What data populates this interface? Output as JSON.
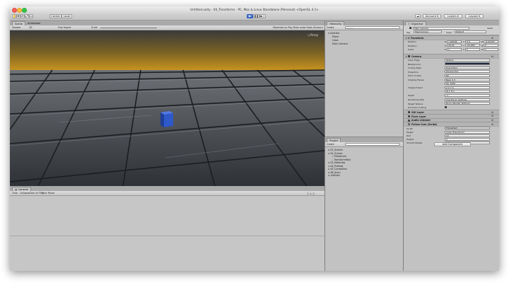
{
  "titlebar": {
    "title": "Untitled.unity - 04_Transforms - PC, Mac & Linux Standalone (Personal) <OpenGL 4.1>"
  },
  "toolbar": {
    "center_label": "Center",
    "local_label": "Local",
    "play_icon": "play-icon",
    "pause_icon": "pause-icon",
    "step_icon": "step-icon",
    "account_label": "Account",
    "layers_label": "Layers",
    "layout_label": "Layout"
  },
  "scene": {
    "tabs": [
      "Scene",
      "Animation"
    ],
    "shading_mode": "Shaded",
    "dimension_mode": "2D",
    "right_labels": "Gizmos ▾ (Q*All)",
    "game_subbar": [
      "Free Aspect",
      "Scale",
      "1x"
    ],
    "game_right": "Maximize on Play   Mute audio   Stats   Gizmos ▾"
  },
  "hierarchy": {
    "tab": "Hierarchy",
    "create_label": "Create",
    "search_placeholder": "Q*All",
    "scene_name": "Untitled",
    "items": [
      "Plane",
      "Cube",
      "Main Camera"
    ]
  },
  "project": {
    "tab": "Project",
    "create_label": "Create",
    "items": [
      "01_Scenes",
      "02_Scripts",
      "FollowCam",
      "TransformMod",
      "03_Materials",
      "04_Prefabs",
      "05_Controllers",
      "06_Anim",
      "Untitled"
    ]
  },
  "console": {
    "tab": "Console",
    "buttons": [
      "Clear",
      "Collapse",
      "Clear on Play",
      "Error Pause"
    ]
  },
  "inspector": {
    "tab": "Inspector",
    "object_name": "Main Camera",
    "static_label": "Static",
    "tag_label": "Tag",
    "tag_value": "MainCamera",
    "layer_label": "Layer",
    "layer_value": "Default",
    "transform": {
      "header": "Transform",
      "rows": [
        {
          "label": "Position",
          "x": "7.99158",
          "y": "5.5",
          "z": "-9.07475"
        },
        {
          "label": "Rotation",
          "x": "26.24",
          "y": "-52.659",
          "z": "0"
        },
        {
          "label": "Scale",
          "x": "1",
          "y": "1",
          "z": "1"
        }
      ]
    },
    "camera": {
      "header": "Camera",
      "rows": [
        {
          "label": "Clear Flags",
          "value": "Skybox"
        },
        {
          "label": "Background",
          "value": ""
        },
        {
          "label": "Culling Mask",
          "value": "Everything"
        },
        {
          "label": "Projection",
          "value": "Perspective"
        },
        {
          "label": "Field of View",
          "value": "60"
        },
        {
          "label": "Clipping Planes",
          "value": "Near  0.3"
        },
        {
          "label": "",
          "value": "Far  1000"
        },
        {
          "label": "Viewport Rect",
          "value": "X 0   Y 0"
        },
        {
          "label": "",
          "value": "W 1   H 1"
        },
        {
          "label": "Depth",
          "value": "-1"
        },
        {
          "label": "Rendering Path",
          "value": "Use Player Settings"
        },
        {
          "label": "Target Texture",
          "value": "None (Render Texture)"
        },
        {
          "label": "Occlusion Culling",
          "value": ""
        },
        {
          "label": "HDR",
          "value": ""
        },
        {
          "label": "Target Display",
          "value": "Display 1"
        }
      ]
    },
    "components": [
      "GUI Layer",
      "Flare Layer",
      "Audio Listener",
      "Follow Cam (Script)"
    ],
    "script_label": "Script",
    "script_value": "FollowCam",
    "follow_fields": [
      {
        "label": "Target",
        "value": "Cube (Transform)"
      },
      {
        "label": "Dist",
        "value": "10"
      },
      {
        "label": "Height",
        "value": "3"
      },
      {
        "label": "Smooth Rotate",
        "value": "5"
      }
    ],
    "add_component": "Add Component"
  },
  "colors": {
    "accent": "#3b68c6",
    "panel": "#c2c2c2",
    "sky_top": "#3a3a3a",
    "sky_bottom": "#c79320",
    "cube": "#2f58c8"
  }
}
